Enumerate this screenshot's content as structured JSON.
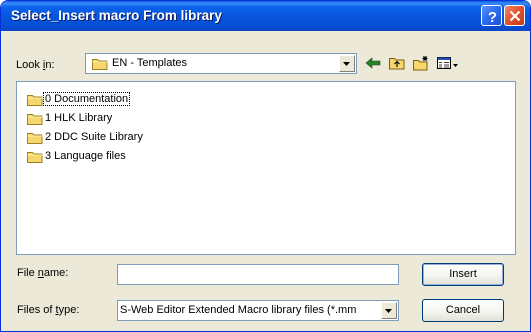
{
  "window": {
    "title": "Select_Insert macro From library"
  },
  "lookin": {
    "label_pre": "Look ",
    "label_accel": "i",
    "label_post": "n:",
    "value": "EN - Templates"
  },
  "toolbar": {
    "icons": [
      "back-arrow-icon",
      "up-folder-icon",
      "new-folder-icon",
      "view-menu-icon"
    ]
  },
  "files": [
    {
      "name": "0 Documentation",
      "focused": true
    },
    {
      "name": "1 HLK Library",
      "focused": false
    },
    {
      "name": "2 DDC Suite Library",
      "focused": false
    },
    {
      "name": "3 Language files",
      "focused": false
    }
  ],
  "filename": {
    "label_pre": "File ",
    "label_accel": "n",
    "label_post": "ame:",
    "value": ""
  },
  "filetype": {
    "label_pre": "Files of ",
    "label_accel": "t",
    "label_post": "ype:",
    "value": "S-Web Editor Extended Macro library files (*.mm"
  },
  "buttons": {
    "insert": "Insert",
    "cancel": "Cancel"
  },
  "colors": {
    "titlebar": "#0754da",
    "dialog_bg": "#ece9d8",
    "border": "#7f9db9",
    "folder": "#f5d76e"
  }
}
